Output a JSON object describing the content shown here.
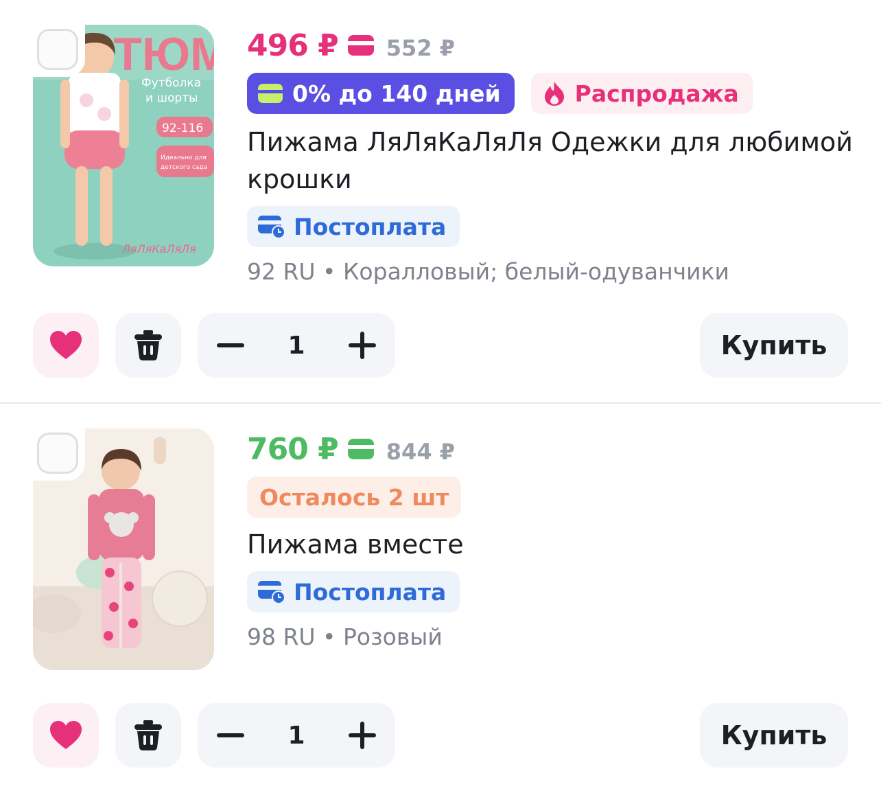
{
  "items": [
    {
      "price": "496 ₽",
      "price_color": "#e6307a",
      "old_price": "552 ₽",
      "badges": {
        "installment": "0% до 140 дней",
        "sale": "Распродажа"
      },
      "title": "Пижама ЛяЛяКаЛяЛя Одежки для любимой крошки",
      "postpay": "Постоплата",
      "variant": "92 RU • Коралловый; белый-одуванчики",
      "quantity": "1",
      "buy_label": "Купить",
      "image": {
        "heading": "СТЮМ",
        "subtitle_line1": "Футболка",
        "subtitle_line2": "и шорты",
        "size_range": "92-116",
        "note_line1": "Идеально для",
        "note_line2": "детского сада",
        "brand": "ЛяЛяКаЛяЛя"
      }
    },
    {
      "price": "760 ₽",
      "price_color": "#4dbb61",
      "old_price": "844 ₽",
      "badges": {
        "stock": "Осталось 2 шт"
      },
      "title": "Пижама вместе",
      "postpay": "Постоплата",
      "variant": "98 RU • Розовый",
      "quantity": "1",
      "buy_label": "Купить"
    }
  ]
}
